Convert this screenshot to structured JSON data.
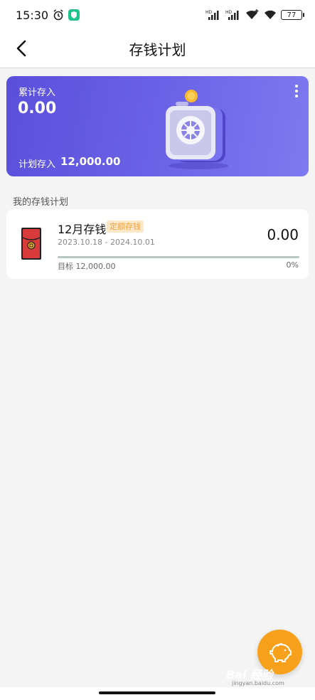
{
  "status_bar": {
    "time": "15:30",
    "battery": "77",
    "icons": [
      "alarm-icon",
      "shield-app-icon",
      "signal-hd-icon",
      "signal-hd-icon",
      "wifi-plus-icon",
      "wifi-icon",
      "battery-icon"
    ]
  },
  "nav": {
    "title": "存钱计划"
  },
  "summary": {
    "accumulated_label": "累计存入",
    "accumulated_value": "0.00",
    "planned_label": "计划存入",
    "planned_value": "12,000.00"
  },
  "section": {
    "title": "我的存钱计划"
  },
  "plans": [
    {
      "name": "12月存钱",
      "tag": "定额存钱",
      "dates": "2023.10.18 - 2024.10.01",
      "amount": "0.00",
      "target": "目标 12,000.00",
      "percent": "0%",
      "progress": 0
    }
  ],
  "watermark": {
    "text": "Bai 经验",
    "sub": "jingyan.baidu.com"
  },
  "colors": {
    "card_gradient_start": "#5a4fdb",
    "card_gradient_end": "#7e7af0",
    "accent_orange": "#f7a01b",
    "tag_bg": "#ffe8c7",
    "tag_text": "#f3a13a",
    "envelope_red": "#d93a3a"
  }
}
